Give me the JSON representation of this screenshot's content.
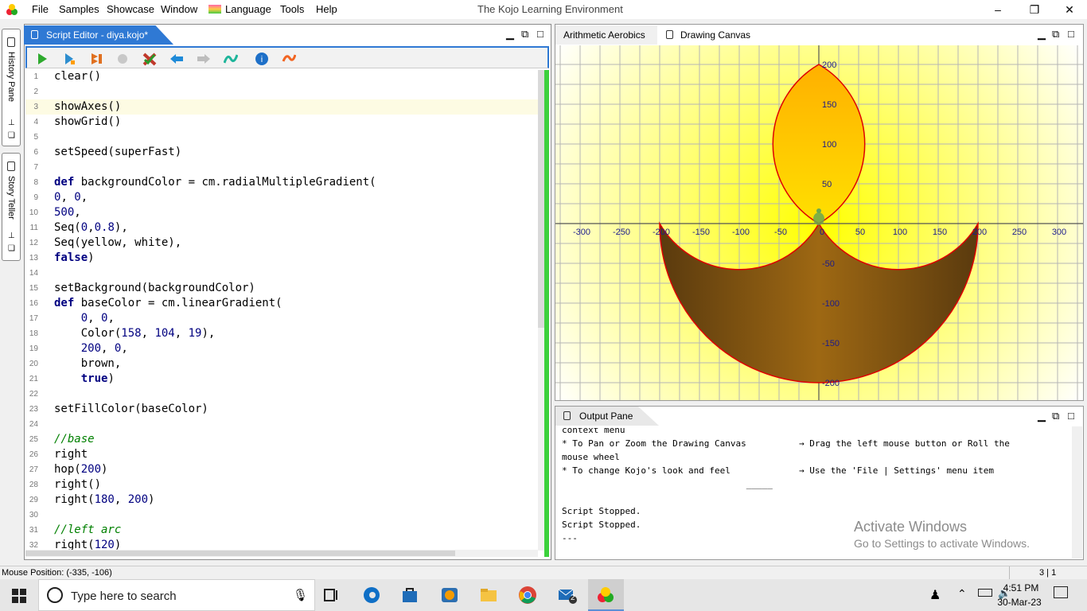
{
  "menu": {
    "items": [
      "File",
      "Samples",
      "Showcase",
      "Window",
      "Language",
      "Tools",
      "Help"
    ],
    "app_title": "The Kojo Learning Environment"
  },
  "side_tabs": [
    "History Pane",
    "Story Teller"
  ],
  "editor": {
    "tab_title": "Script Editor - diya.kojo*",
    "toolbar": [
      "run-icon",
      "step-icon",
      "run-worksheet-icon",
      "stop-icon",
      "check-icon",
      "back-icon",
      "forward-icon",
      "format-icon",
      "help-icon",
      "reset-icon"
    ],
    "lines": [
      {
        "n": "1",
        "t": "clear()"
      },
      {
        "n": "2",
        "t": ""
      },
      {
        "n": "3",
        "t": "showAxes()"
      },
      {
        "n": "4",
        "t": "showGrid()"
      },
      {
        "n": "5",
        "t": ""
      },
      {
        "n": "6",
        "t": "setSpeed(superFast)"
      },
      {
        "n": "7",
        "t": ""
      },
      {
        "n": "8",
        "t": "def backgroundColor = cm.radialMultipleGradient("
      },
      {
        "n": "9",
        "t": "0, 0,"
      },
      {
        "n": "10",
        "t": "500,"
      },
      {
        "n": "11",
        "t": "Seq(0,0.8),"
      },
      {
        "n": "12",
        "t": "Seq(yellow, white),"
      },
      {
        "n": "13",
        "t": "false)"
      },
      {
        "n": "14",
        "t": ""
      },
      {
        "n": "15",
        "t": "setBackground(backgroundColor)"
      },
      {
        "n": "16",
        "t": "def baseColor = cm.linearGradient("
      },
      {
        "n": "17",
        "t": "    0, 0,"
      },
      {
        "n": "18",
        "t": "    Color(158, 104, 19),"
      },
      {
        "n": "19",
        "t": "    200, 0,"
      },
      {
        "n": "20",
        "t": "    brown,"
      },
      {
        "n": "21",
        "t": "    true)"
      },
      {
        "n": "22",
        "t": ""
      },
      {
        "n": "23",
        "t": "setFillColor(baseColor)"
      },
      {
        "n": "24",
        "t": ""
      },
      {
        "n": "25",
        "t": "//base"
      },
      {
        "n": "26",
        "t": "right"
      },
      {
        "n": "27",
        "t": "hop(200)"
      },
      {
        "n": "28",
        "t": "right()"
      },
      {
        "n": "29",
        "t": "right(180, 200)"
      },
      {
        "n": "30",
        "t": ""
      },
      {
        "n": "31",
        "t": "//left arc"
      },
      {
        "n": "32",
        "t": "right(120)"
      }
    ]
  },
  "canvas": {
    "tabs": [
      "Arithmetic Aerobics",
      "Drawing Canvas"
    ],
    "x_ticks": [
      "-300",
      "-250",
      "-200",
      "-150",
      "-100",
      "-50",
      "0",
      "50",
      "100",
      "150",
      "200",
      "250",
      "300"
    ],
    "y_ticks": [
      "200",
      "150",
      "100",
      "50",
      "-50",
      "-100",
      "-150",
      "-200"
    ],
    "base_color": "#9e6813",
    "flame_color": "#ffc000",
    "outline_color": "#e00000"
  },
  "output": {
    "tab_title": "Output Pane",
    "lines": [
      "context menu",
      "* To Pan or Zoom the Drawing Canvas          → Drag the left mouse button or Roll the",
      "mouse wheel",
      "* To change Kojo's look and feel             → Use the 'File | Settings' menu item",
      "                                   _____",
      "",
      "Script Stopped.",
      "Script Stopped.",
      "---"
    ],
    "watermark_title": "Activate Windows",
    "watermark_sub": "Go to Settings to activate Windows."
  },
  "status": {
    "mouse_position": "Mouse Position: (-335, -106)",
    "cursor": "3 | 1"
  },
  "taskbar": {
    "search_placeholder": "Type here to search",
    "time": "4:51 PM",
    "date": "30-Mar-23",
    "mail_badge": "2"
  }
}
